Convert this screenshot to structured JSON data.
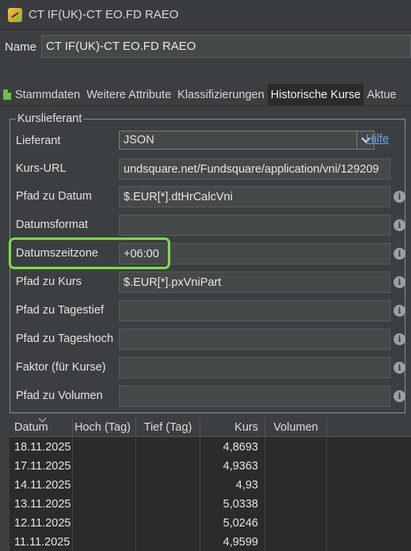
{
  "window": {
    "title": "CT IF(UK)-CT EO.FD RAEO"
  },
  "name": {
    "label": "Name",
    "value": "CT IF(UK)-CT EO.FD RAEO"
  },
  "tabs": [
    {
      "label": "Stammdaten",
      "icon": "document-icon"
    },
    {
      "label": "Weitere Attribute"
    },
    {
      "label": "Klassifizierungen"
    },
    {
      "label": "Historische Kurse",
      "active": true
    },
    {
      "label": "Aktue"
    }
  ],
  "provider": {
    "group_label": "Kurslieferant",
    "lieferant": {
      "label": "Lieferant",
      "value": "JSON",
      "help": "Hilfe"
    },
    "fields": [
      {
        "label": "Kurs-URL",
        "value": "undsquare.net/Fundsquare/application/vni/129209"
      },
      {
        "label": "Pfad zu Datum",
        "value": "$.EUR[*].dtHrCalcVni"
      },
      {
        "label": "Datumsformat",
        "value": ""
      },
      {
        "label": "Datumszeitzone",
        "value": "+06:00"
      },
      {
        "label": "Pfad zu Kurs",
        "value": "$.EUR[*].pxVniPart"
      },
      {
        "label": "Pfad zu Tagestief",
        "value": ""
      },
      {
        "label": "Pfad zu Tageshoch",
        "value": ""
      },
      {
        "label": "Faktor (für Kurse)",
        "value": ""
      },
      {
        "label": "Pfad zu Volumen",
        "value": ""
      }
    ]
  },
  "table": {
    "columns": [
      "Datum",
      "Hoch (Tag)",
      "Tief (Tag)",
      "Kurs",
      "Volumen"
    ],
    "rows": [
      {
        "datum": "18.11.2025",
        "kurs": "4,8693"
      },
      {
        "datum": "17.11.2025",
        "kurs": "4,9363"
      },
      {
        "datum": "14.11.2025",
        "kurs": "4,93"
      },
      {
        "datum": "13.11.2025",
        "kurs": "5,0338"
      },
      {
        "datum": "12.11.2025",
        "kurs": "5,0246"
      },
      {
        "datum": "11.11.2025",
        "kurs": "4,9599"
      }
    ]
  },
  "colors": {
    "highlight": "#7ddc4c",
    "link": "#6aa6e8",
    "background": "#3c3f41"
  }
}
